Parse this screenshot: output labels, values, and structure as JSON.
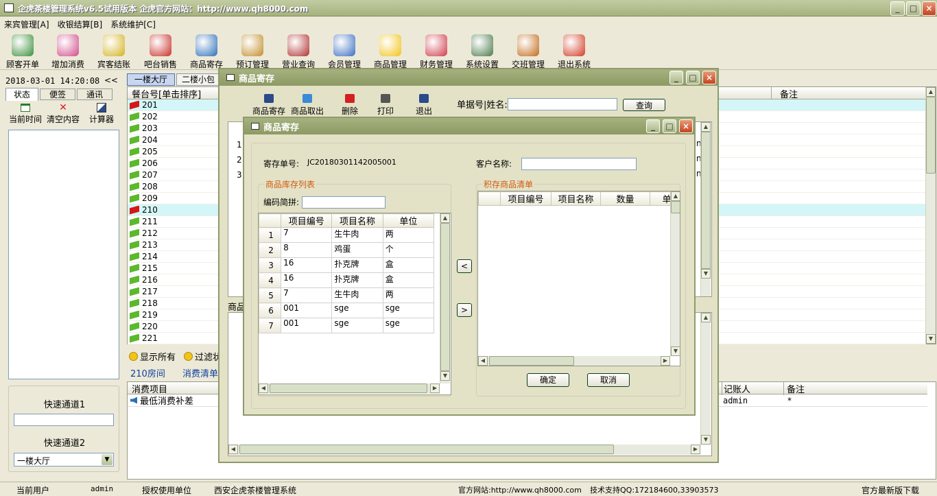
{
  "app": {
    "title": "企虎茶楼管理系统v6.5试用版本 企虎官方网站：http://www.qh8000.com"
  },
  "menu": [
    "来宾管理[A]",
    "收银结算[B]",
    "系统维护[C]"
  ],
  "toolbar": [
    {
      "label": "顾客开单",
      "icon": "cup-icon",
      "color": "#3a8f3a"
    },
    {
      "label": "增加消费",
      "icon": "plus-icon",
      "color": "#d24a8a"
    },
    {
      "label": "宾客结账",
      "icon": "arrow-icon",
      "color": "#d4b21e"
    },
    {
      "label": "吧台销售",
      "icon": "basket-icon",
      "color": "#c8302a"
    },
    {
      "label": "商品寄存",
      "icon": "bag-icon",
      "color": "#2c6fb8"
    },
    {
      "label": "预订管理",
      "icon": "clock-icon",
      "color": "#c28d2a"
    },
    {
      "label": "营业查询",
      "icon": "search-doc-icon",
      "color": "#b03030"
    },
    {
      "label": "会员管理",
      "icon": "users-icon",
      "color": "#3b6ec2"
    },
    {
      "label": "商品管理",
      "icon": "star-icon",
      "color": "#f2c417"
    },
    {
      "label": "财务管理",
      "icon": "calculator-icon",
      "color": "#d03a4a"
    },
    {
      "label": "系统设置",
      "icon": "settings-icon",
      "color": "#4c7a4c"
    },
    {
      "label": "交班管理",
      "icon": "exit-door-icon",
      "color": "#c26a1a"
    },
    {
      "label": "退出系统",
      "icon": "power-icon",
      "color": "#d13b23"
    }
  ],
  "left": {
    "datetime": "2018-03-01 14:20:08",
    "collapse": "<<",
    "tabs": [
      "状态",
      "便签",
      "通讯"
    ],
    "tools": [
      "当前时间",
      "清空内容",
      "计算器"
    ],
    "quick1": "快速通道1",
    "quick2": "快速通道2",
    "quick2_value": "一楼大厅"
  },
  "floors": [
    "一楼大厅",
    "二楼小包"
  ],
  "rooms": {
    "header": "餐台号[单击排序]",
    "note_header": "备注",
    "items": [
      "201",
      "202",
      "203",
      "204",
      "205",
      "206",
      "207",
      "208",
      "209",
      "210",
      "211",
      "212",
      "213",
      "214",
      "215",
      "216",
      "217",
      "218",
      "219",
      "220",
      "221"
    ]
  },
  "filters": {
    "show_all": "显示所有",
    "filter_status": "过滤状"
  },
  "consume": {
    "room_label": "210房间",
    "list_tab": "消费清单",
    "col_item": "消费项目",
    "row_item": "最低消费补差",
    "col_account": "记账人",
    "col_note": "备注",
    "account": "admin",
    "note": "*"
  },
  "outer_dialog": {
    "title": "商品寄存",
    "tools": [
      "商品寄存",
      "商品取出",
      "删除",
      "打印",
      "退出"
    ],
    "search_label": "单据号|姓名:",
    "search_btn": "查询",
    "row_nums": [
      "1",
      "2",
      "3"
    ],
    "cell_text": [
      "n",
      "n",
      "n"
    ],
    "lower_label": "商品"
  },
  "inner_dialog": {
    "title": "商品寄存",
    "order_label": "寄存单号:",
    "order_no": "JC20180301142005001",
    "customer_label": "客户名称:",
    "stock_group": "商品库存列表",
    "code_label": "编码简拼:",
    "cols": [
      "项目编号",
      "项目名称",
      "单位"
    ],
    "stock_rows": [
      {
        "n": "1",
        "code": "7",
        "name": "生牛肉",
        "unit": "两"
      },
      {
        "n": "2",
        "code": "8",
        "name": "鸡蛋",
        "unit": "个"
      },
      {
        "n": "3",
        "code": "16",
        "name": "扑克牌",
        "unit": "盒"
      },
      {
        "n": "4",
        "code": "16",
        "name": "扑克牌",
        "unit": "盒"
      },
      {
        "n": "5",
        "code": "7",
        "name": "生牛肉",
        "unit": "两"
      },
      {
        "n": "6",
        "code": "001",
        "name": "sge",
        "unit": "sge"
      },
      {
        "n": "7",
        "code": "001",
        "name": "sge",
        "unit": "sge"
      }
    ],
    "left_arrow": "<",
    "right_arrow": ">",
    "deposit_group": "积存商品清单",
    "deposit_cols": [
      "项目编号",
      "项目名称",
      "数量",
      "单"
    ],
    "ok": "确定",
    "cancel": "取消"
  },
  "status": {
    "user_label": "当前用户",
    "user": "admin",
    "license_label": "授权使用单位",
    "license": "西安企虎茶楼管理系统",
    "website": "官方网站:http://www.qh8000.com",
    "support": "技术支持QQ:172184600,33903573",
    "download": "官方最新版下载"
  }
}
